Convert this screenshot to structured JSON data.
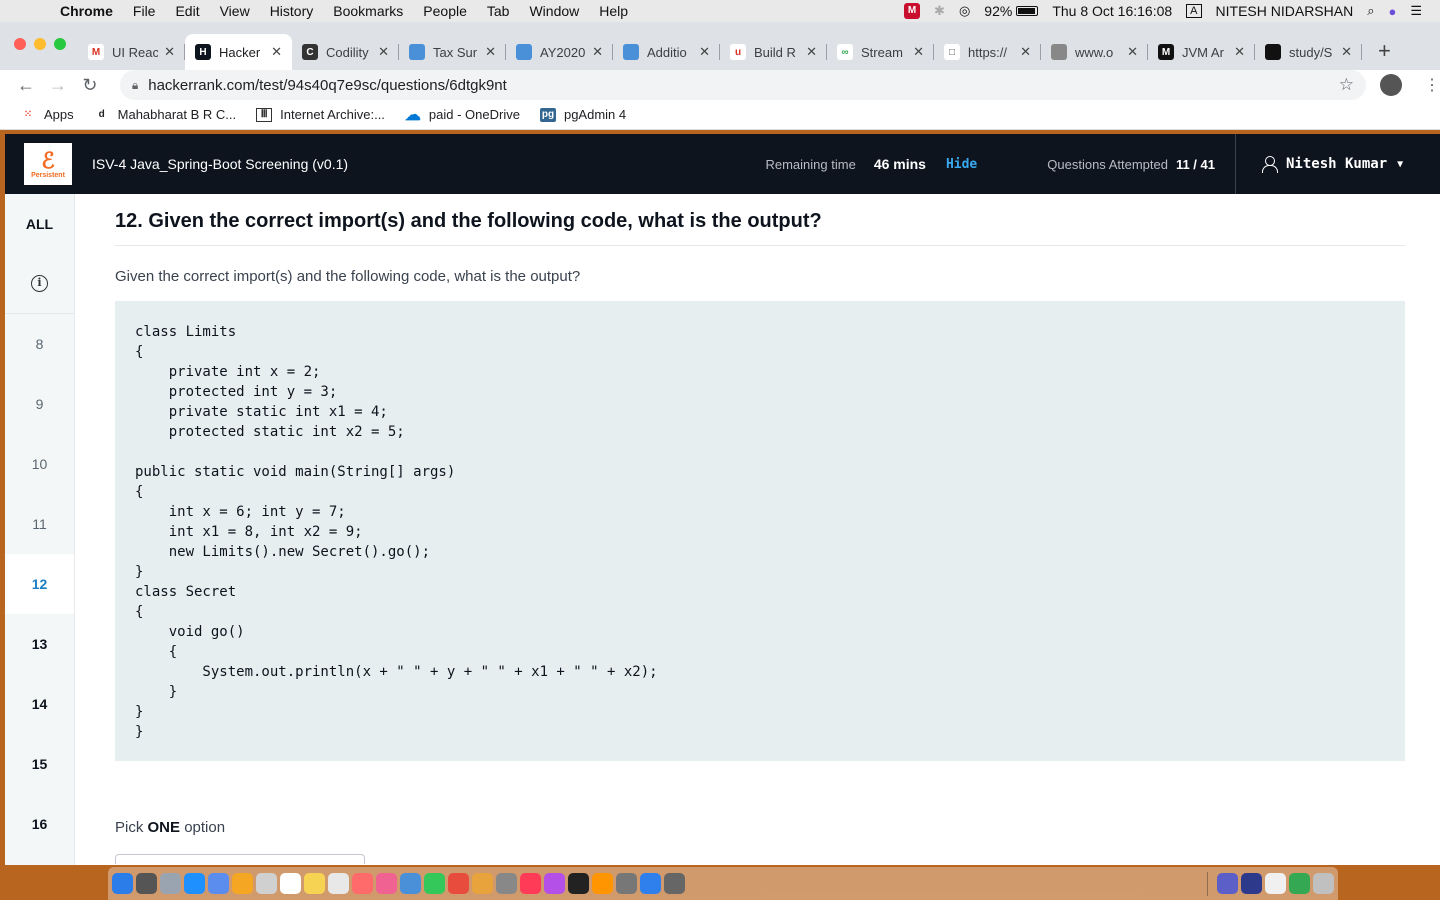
{
  "menubar": {
    "app_name": "Chrome",
    "items": [
      "File",
      "Edit",
      "View",
      "History",
      "Bookmarks",
      "People",
      "Tab",
      "Window",
      "Help"
    ],
    "battery": "92%",
    "datetime": "Thu 8 Oct  16:16:08",
    "input_source": "A",
    "user": "NITESH NIDARSHAN"
  },
  "tabs": [
    {
      "title": "UI Reac",
      "fav_color": "#ffffff",
      "fav_text": "M",
      "fav_fg": "#d93025"
    },
    {
      "title": "Hacker",
      "fav_color": "#0e141e",
      "fav_text": "H",
      "fav_fg": "#ffffff"
    },
    {
      "title": "Codility",
      "fav_color": "#333333",
      "fav_text": "C",
      "fav_fg": "#ffffff"
    },
    {
      "title": "Tax Sur",
      "fav_color": "#4a90d9",
      "fav_text": "",
      "fav_fg": "#ffffff"
    },
    {
      "title": "AY2020",
      "fav_color": "#4a90d9",
      "fav_text": "",
      "fav_fg": "#ffffff"
    },
    {
      "title": "Additio",
      "fav_color": "#4a90d9",
      "fav_text": "",
      "fav_fg": "#ffffff"
    },
    {
      "title": "Build R",
      "fav_color": "#ffffff",
      "fav_text": "u",
      "fav_fg": "#d93025"
    },
    {
      "title": "Stream",
      "fav_color": "#ffffff",
      "fav_text": "∞",
      "fav_fg": "#34a853"
    },
    {
      "title": "https://",
      "fav_color": "#ffffff",
      "fav_text": "□",
      "fav_fg": "#555555"
    },
    {
      "title": "www.o",
      "fav_color": "#888888",
      "fav_text": "",
      "fav_fg": "#ffffff"
    },
    {
      "title": "JVM Ar",
      "fav_color": "#111111",
      "fav_text": "M",
      "fav_fg": "#ffffff"
    },
    {
      "title": "study/S",
      "fav_color": "#111111",
      "fav_text": "",
      "fav_fg": "#ffffff"
    }
  ],
  "active_tab_index": 1,
  "address": {
    "url": "hackerrank.com/test/94s40q7e9sc/questions/6dtgk9nt"
  },
  "bookmarks": [
    {
      "label": "Apps",
      "icon": "apps-grid-icon"
    },
    {
      "label": "Mahabharat B R C...",
      "icon": "d-icon"
    },
    {
      "label": "Internet Archive:...",
      "icon": "archive-icon"
    },
    {
      "label": "paid - OneDrive",
      "icon": "onedrive-icon"
    },
    {
      "label": "pgAdmin 4",
      "icon": "pgadmin-icon"
    }
  ],
  "header": {
    "logo_text": "Persistent",
    "test_title": "ISV-4 Java_Spring-Boot Screening (v0.1)",
    "remaining_label": "Remaining time",
    "remaining_value": "46 mins",
    "hide_label": "Hide",
    "attempted_label": "Questions Attempted",
    "attempted_value": "11 / 41",
    "user_name": "Nitesh Kumar"
  },
  "sidebar": {
    "all_label": "ALL",
    "questions": [
      {
        "num": "8",
        "state": "normal"
      },
      {
        "num": "9",
        "state": "normal"
      },
      {
        "num": "10",
        "state": "normal"
      },
      {
        "num": "11",
        "state": "normal"
      },
      {
        "num": "12",
        "state": "active"
      },
      {
        "num": "13",
        "state": "bold"
      },
      {
        "num": "14",
        "state": "bold"
      },
      {
        "num": "15",
        "state": "bold"
      },
      {
        "num": "16",
        "state": "bold"
      }
    ]
  },
  "question": {
    "title": "12. Given the correct import(s) and the following code, what is the output?",
    "text": "Given the correct import(s) and the following code, what is the output?",
    "code": "class Limits\n{\n    private int x = 2;\n    protected int y = 3;\n    private static int x1 = 4;\n    protected static int x2 = 5;\n\npublic static void main(String[] args)\n{\n    int x = 6; int y = 7;\n    int x1 = 8, int x2 = 9;\n    new Limits().new Secret().go();\n}\nclass Secret\n{\n    void go()\n    {\n        System.out.println(x + \" \" + y + \" \" + x1 + \" \" + x2);\n    }\n}\n}",
    "pick_prefix": "Pick ",
    "pick_bold": "ONE",
    "pick_suffix": " option"
  },
  "dock": {
    "left_apps": [
      "#2b7de9",
      "#555555",
      "#9aa4b1",
      "#1e90ff",
      "#5a8dee",
      "#f5a623",
      "#d0d0d0",
      "#ffffff",
      "#f7d354",
      "#e8e8e8",
      "#ff6b6b",
      "#f06292",
      "#4a90d9",
      "#34c759",
      "#e74c3c",
      "#e8a33d",
      "#888888",
      "#ff3b58",
      "#b44fe8",
      "#222222",
      "#ff9500",
      "#777777",
      "#2f80ed",
      "#666666"
    ],
    "right_apps": [
      "#5b5fc7",
      "#2d3a8c",
      "#f0f0f0",
      "#34a853",
      "#c0c0c0"
    ]
  }
}
